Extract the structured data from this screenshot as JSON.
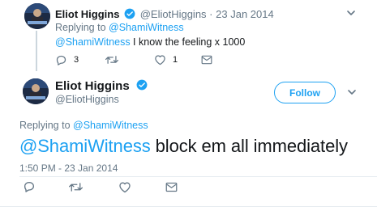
{
  "parent_tweet": {
    "author_name": "Eliot Higgins",
    "author_handle": "@EliotHiggins",
    "separator": "·",
    "date": "23 Jan 2014",
    "replying_prefix": "Replying to",
    "replying_to": "@ShamiWitness",
    "mention": "@ShamiWitness",
    "text": " I know the feeling x 1000",
    "reply_count": "3",
    "retweet_count": "",
    "like_count": "1"
  },
  "main_tweet": {
    "author_name": "Eliot Higgins",
    "author_handle": "@EliotHiggins",
    "follow_label": "Follow",
    "replying_prefix": "Replying to",
    "replying_to": "@ShamiWitness",
    "mention": "@ShamiWitness",
    "text": " block em all immediately",
    "timestamp": "1:50 PM - 23 Jan 2014"
  },
  "icons": {
    "verified": "verified-badge-icon",
    "caret": "chevron-down-icon",
    "reply": "reply-icon",
    "retweet": "retweet-icon",
    "like": "heart-icon",
    "dm": "envelope-icon"
  },
  "colors": {
    "accent": "#1da1f2",
    "muted": "#657786",
    "text": "#14171a",
    "thread_line": "#ccd6dd"
  }
}
